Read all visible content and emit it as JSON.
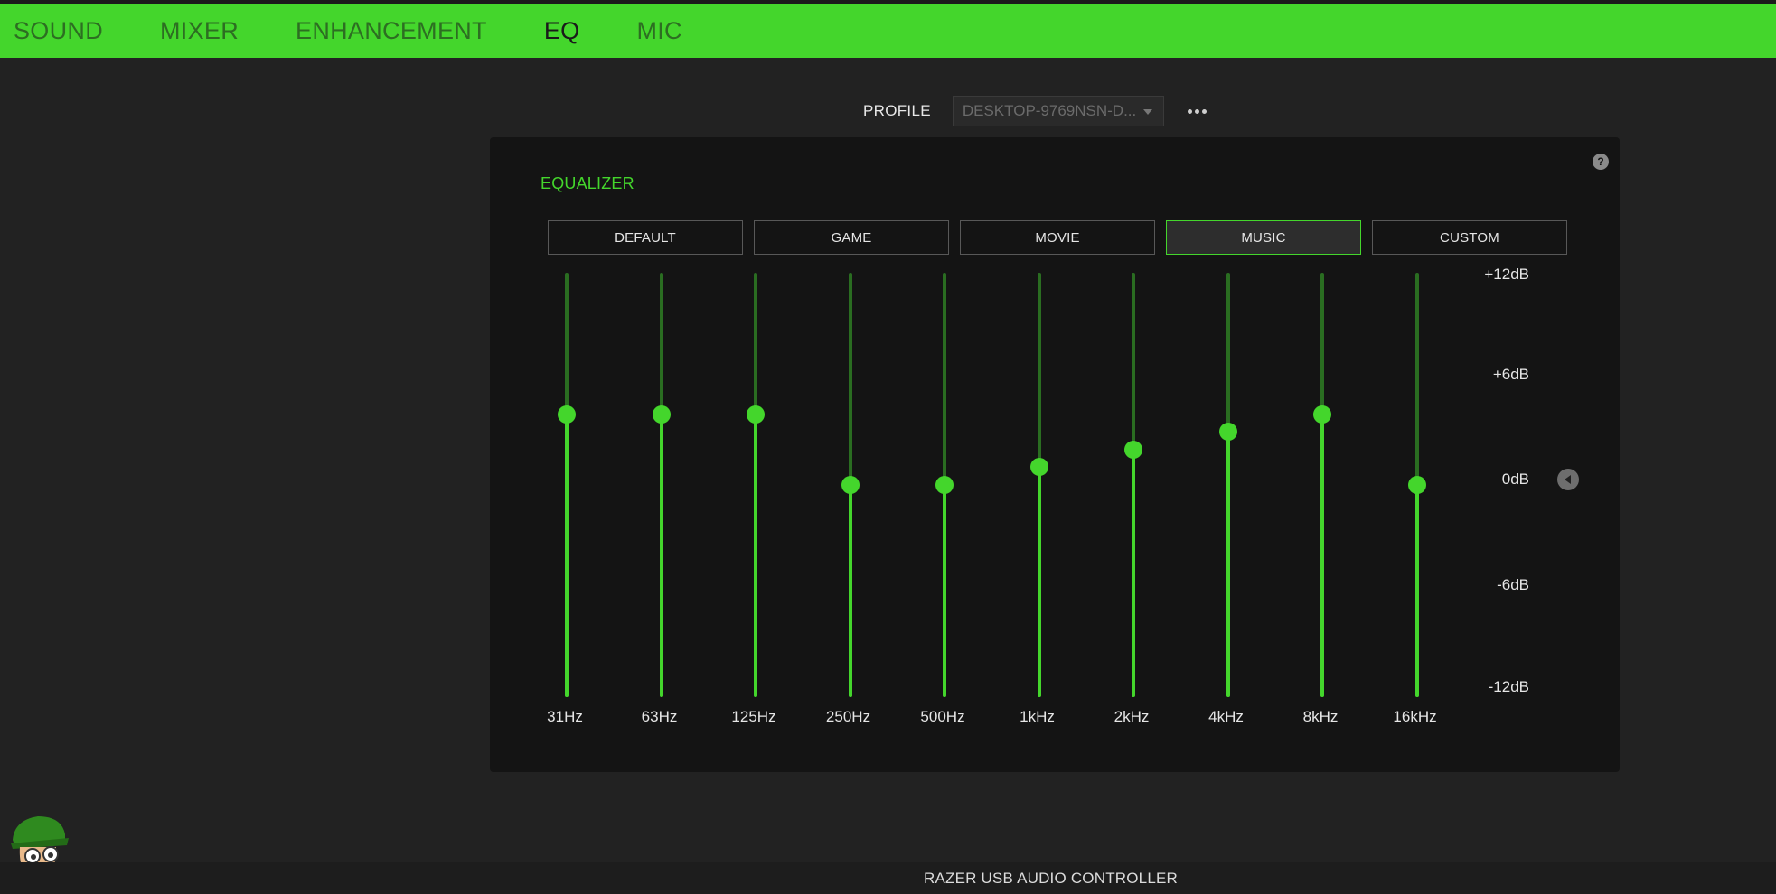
{
  "tabs": [
    {
      "label": "SOUND",
      "active": false
    },
    {
      "label": "MIXER",
      "active": false
    },
    {
      "label": "ENHANCEMENT",
      "active": false
    },
    {
      "label": "EQ",
      "active": true
    },
    {
      "label": "MIC",
      "active": false
    }
  ],
  "profile": {
    "label": "PROFILE",
    "value": "DESKTOP-9769NSN-D..."
  },
  "help_icon": "question-icon",
  "equalizer": {
    "title": "EQUALIZER",
    "presets": [
      {
        "label": "DEFAULT",
        "selected": false
      },
      {
        "label": "GAME",
        "selected": false
      },
      {
        "label": "MOVIE",
        "selected": false
      },
      {
        "label": "MUSIC",
        "selected": true
      },
      {
        "label": "CUSTOM",
        "selected": false
      }
    ],
    "range_db": [
      -12,
      12
    ],
    "bands": [
      {
        "label": "31Hz",
        "db": 4
      },
      {
        "label": "63Hz",
        "db": 4
      },
      {
        "label": "125Hz",
        "db": 4
      },
      {
        "label": "250Hz",
        "db": 0
      },
      {
        "label": "500Hz",
        "db": 0
      },
      {
        "label": "1kHz",
        "db": 1
      },
      {
        "label": "2kHz",
        "db": 2
      },
      {
        "label": "4kHz",
        "db": 3
      },
      {
        "label": "8kHz",
        "db": 4
      },
      {
        "label": "16kHz",
        "db": 0
      }
    ],
    "scale_labels": [
      "+12dB",
      "+6dB",
      "0dB",
      "-6dB",
      "-12dB"
    ]
  },
  "colors": {
    "accent": "#44d62c",
    "track": "#2a6d21",
    "panel": "#141414",
    "background": "#222222"
  },
  "footer": {
    "device": "RAZER USB AUDIO CONTROLLER"
  }
}
